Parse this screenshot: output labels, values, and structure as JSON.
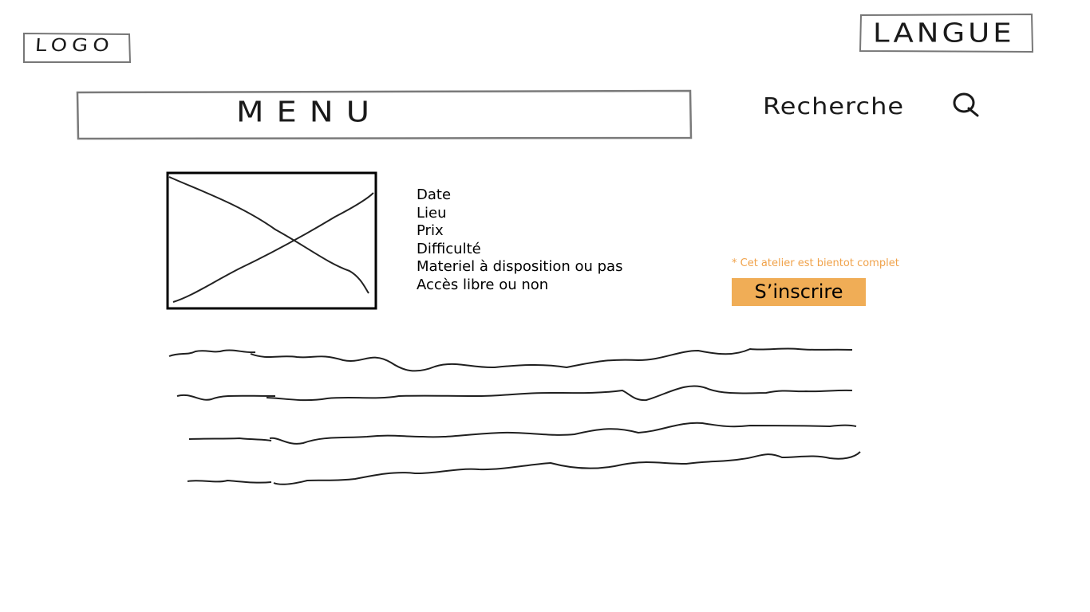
{
  "header": {
    "logo_label": "LOGO",
    "language_label": "LANGUE",
    "menu_label": "MENU",
    "search_label": "Recherche",
    "search_icon": "search-icon"
  },
  "workshop": {
    "image_placeholder": "crossed-box-image-placeholder",
    "details": [
      "Date",
      "Lieu",
      "Prix",
      "Difficulté",
      "Materiel à disposition ou pas",
      "Accès libre ou non"
    ],
    "availability_note": "* Cet atelier est bientot complet",
    "register_label": "S’inscrire"
  },
  "colors": {
    "note": "#f0a24a",
    "button": "#f0ad56",
    "sketch_border": "#7a7a7a",
    "ink": "#1a1a1a"
  }
}
